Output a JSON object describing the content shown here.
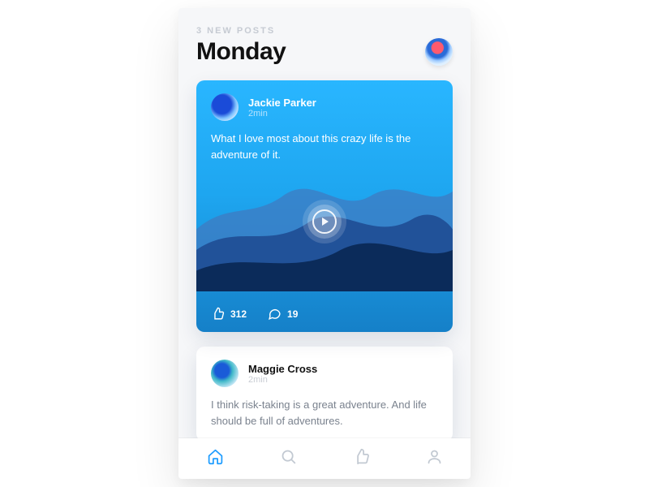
{
  "header": {
    "new_posts_label": "3 NEW POSTS",
    "day_title": "Monday"
  },
  "posts": [
    {
      "author": "Jackie Parker",
      "time": "2min",
      "text": "What I love most about this crazy life is the adventure of it.",
      "likes": "312",
      "comments": "19"
    },
    {
      "author": "Maggie Cross",
      "time": "2min",
      "text": "I think risk-taking is a great adventure. And life should be full of adventures."
    }
  ],
  "tabs": [
    "home",
    "search",
    "likes",
    "profile"
  ],
  "active_tab": "home"
}
